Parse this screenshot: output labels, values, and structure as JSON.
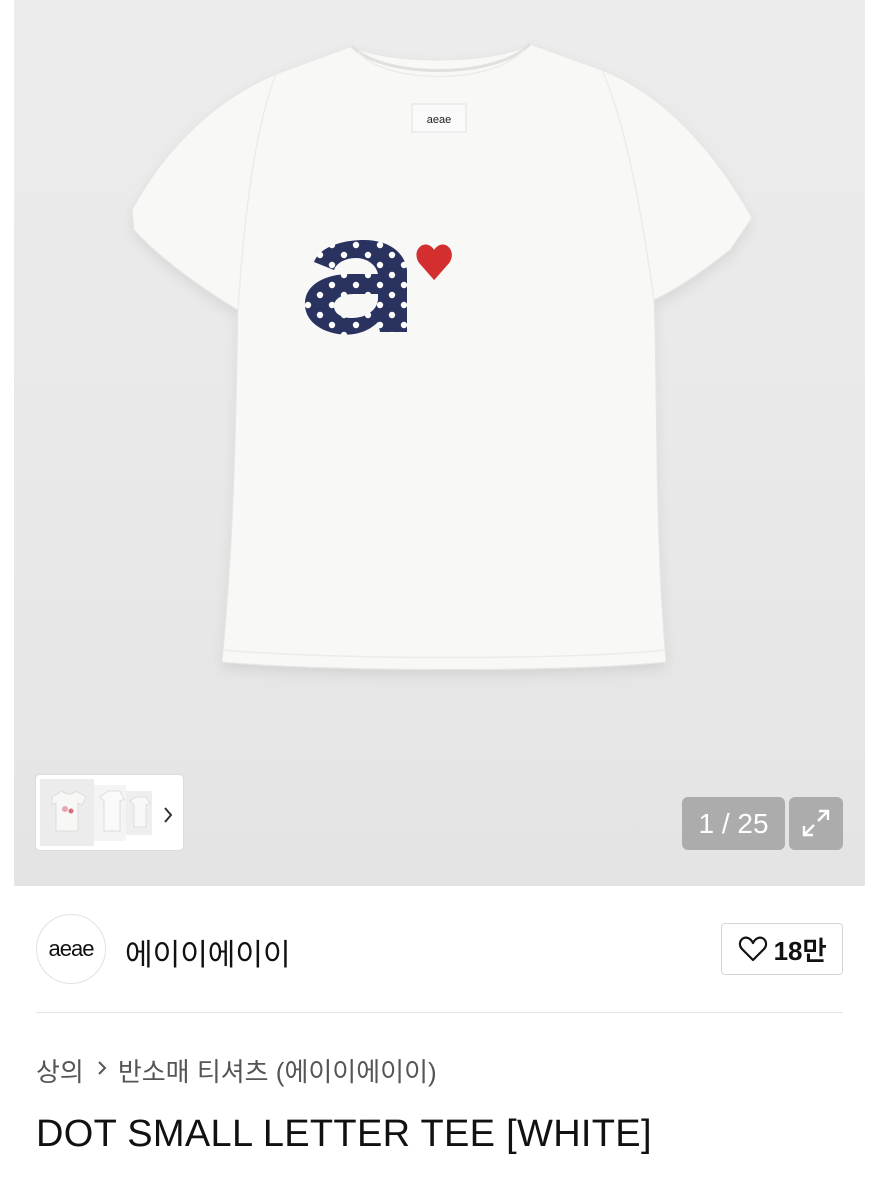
{
  "gallery": {
    "current_page": "1",
    "total_pages": "25",
    "counter_text": "1 / 25",
    "garment_tag_text": "aeae",
    "thumbnail_next_icon": "chevron-right-icon",
    "expand_icon": "expand-arrows-icon",
    "colors": {
      "navy": "#2a3360",
      "heart": "#d32f2f",
      "shirt": "#f7f7f5"
    }
  },
  "brand": {
    "logo_text": "aeae",
    "name": "에이이에이이",
    "like_icon": "heart-outline-icon",
    "like_count": "18만"
  },
  "breadcrumb": {
    "items": [
      "상의",
      "반소매 티셔츠 (에이이에이이)"
    ],
    "separator_icon": "chevron-right-icon"
  },
  "product": {
    "title": "DOT SMALL LETTER TEE [WHITE]"
  }
}
